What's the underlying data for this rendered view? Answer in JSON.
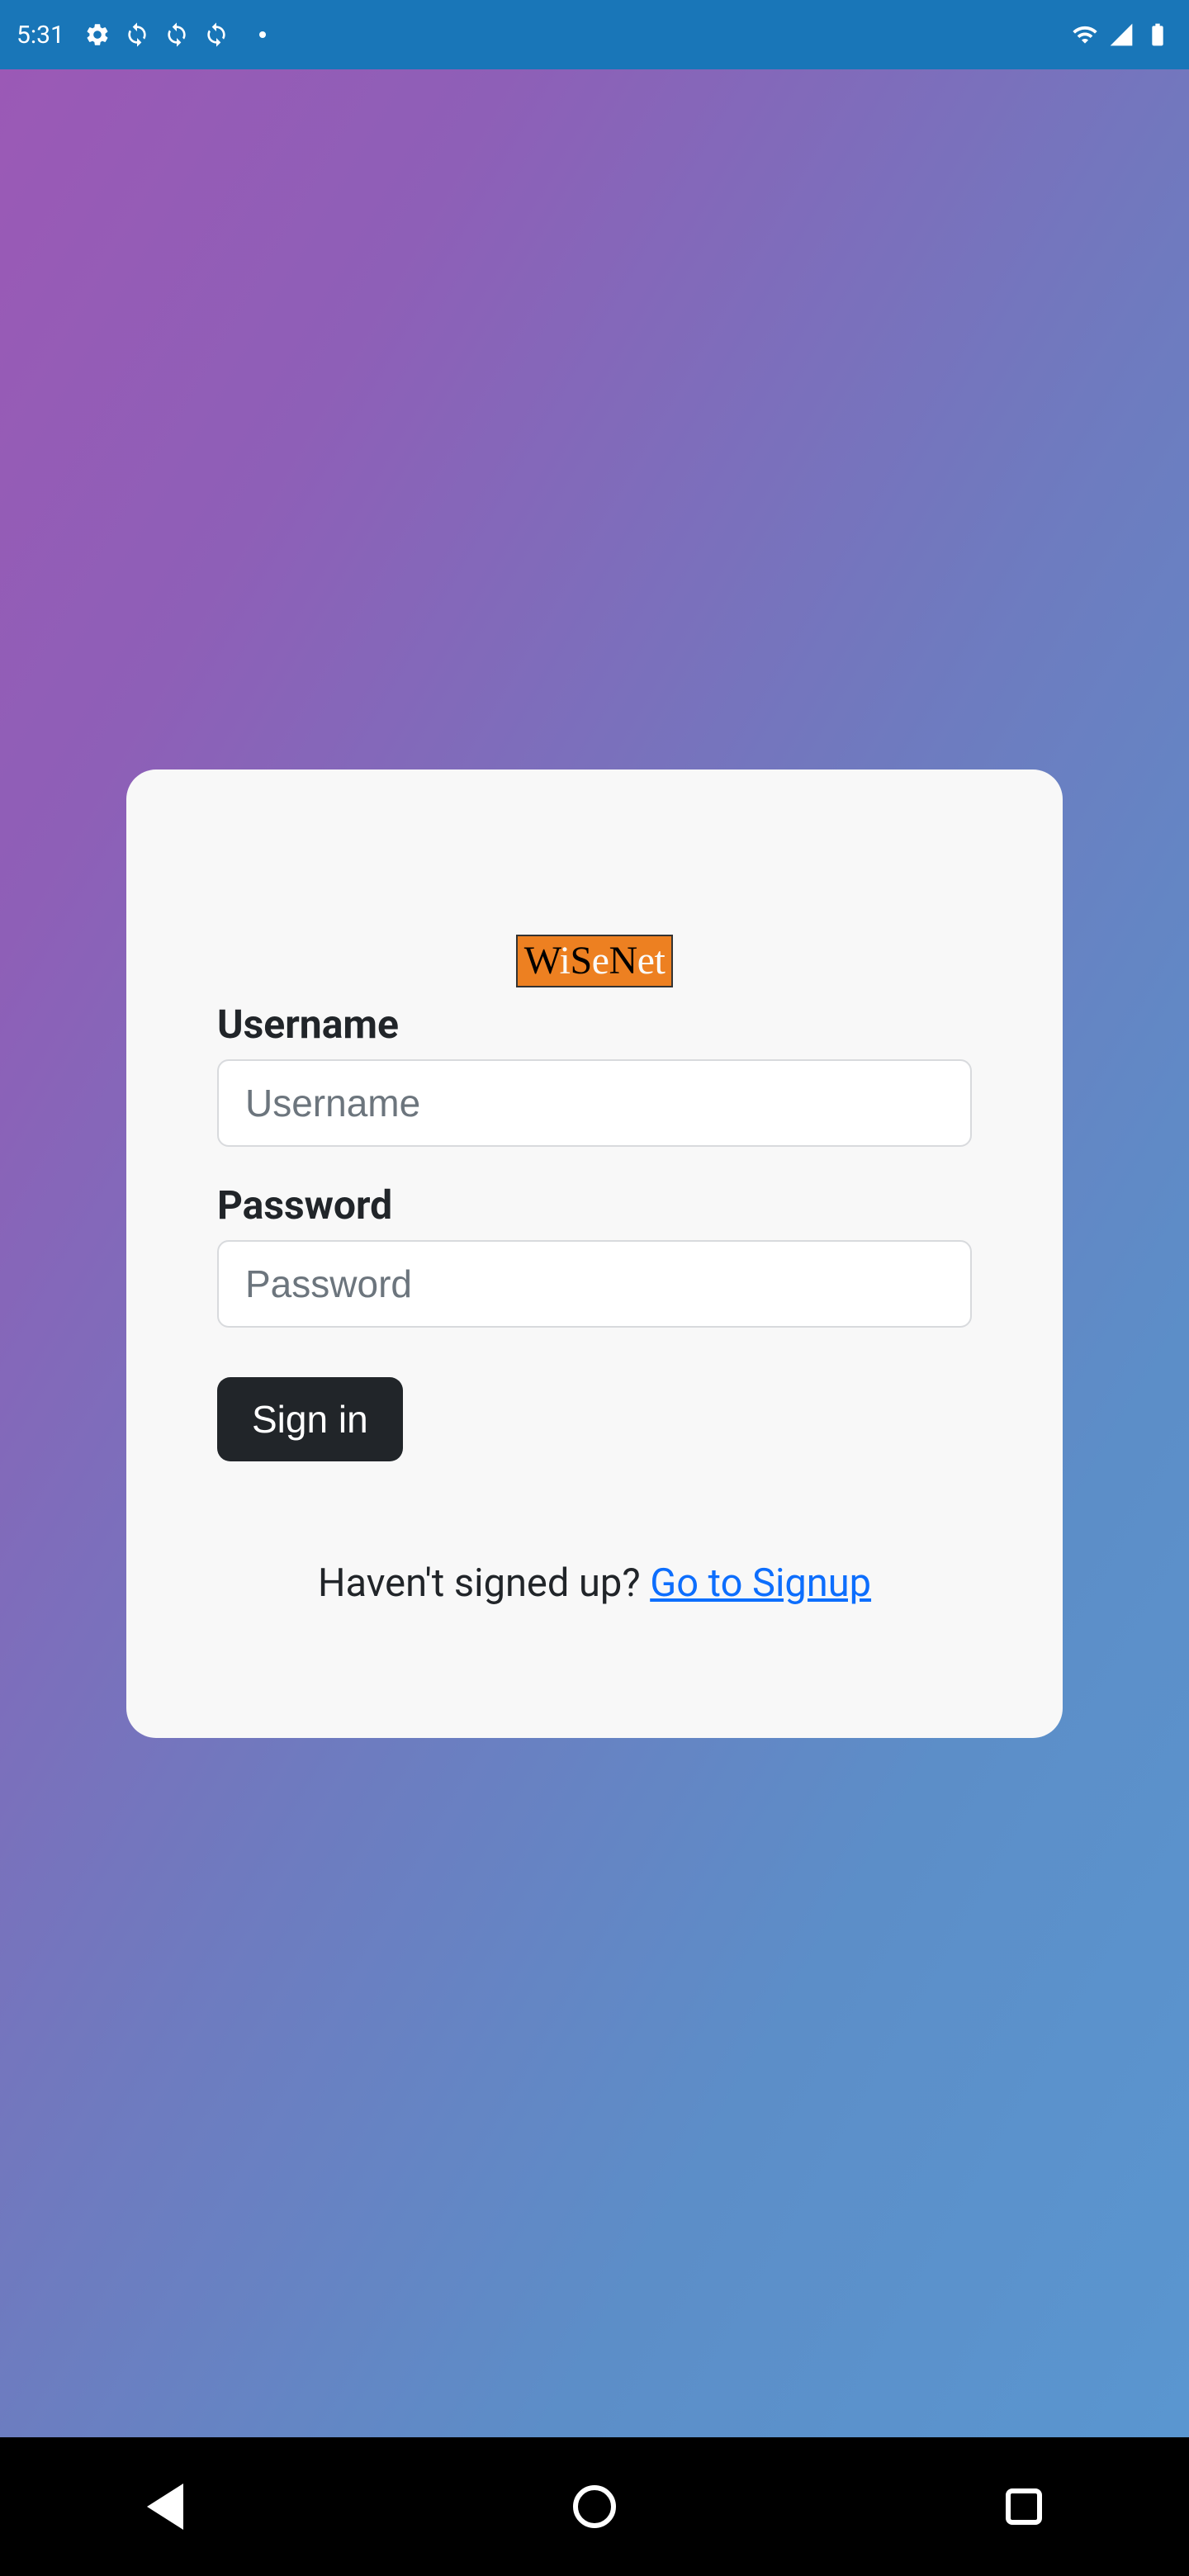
{
  "status_bar": {
    "time": "5:31"
  },
  "logo": {
    "text": "WiSeNet"
  },
  "form": {
    "username": {
      "label": "Username",
      "placeholder": "Username"
    },
    "password": {
      "label": "Password",
      "placeholder": "Password"
    },
    "signin_button": "Sign in"
  },
  "signup": {
    "prompt": "Haven't signed up? ",
    "link": "Go to Signup"
  }
}
